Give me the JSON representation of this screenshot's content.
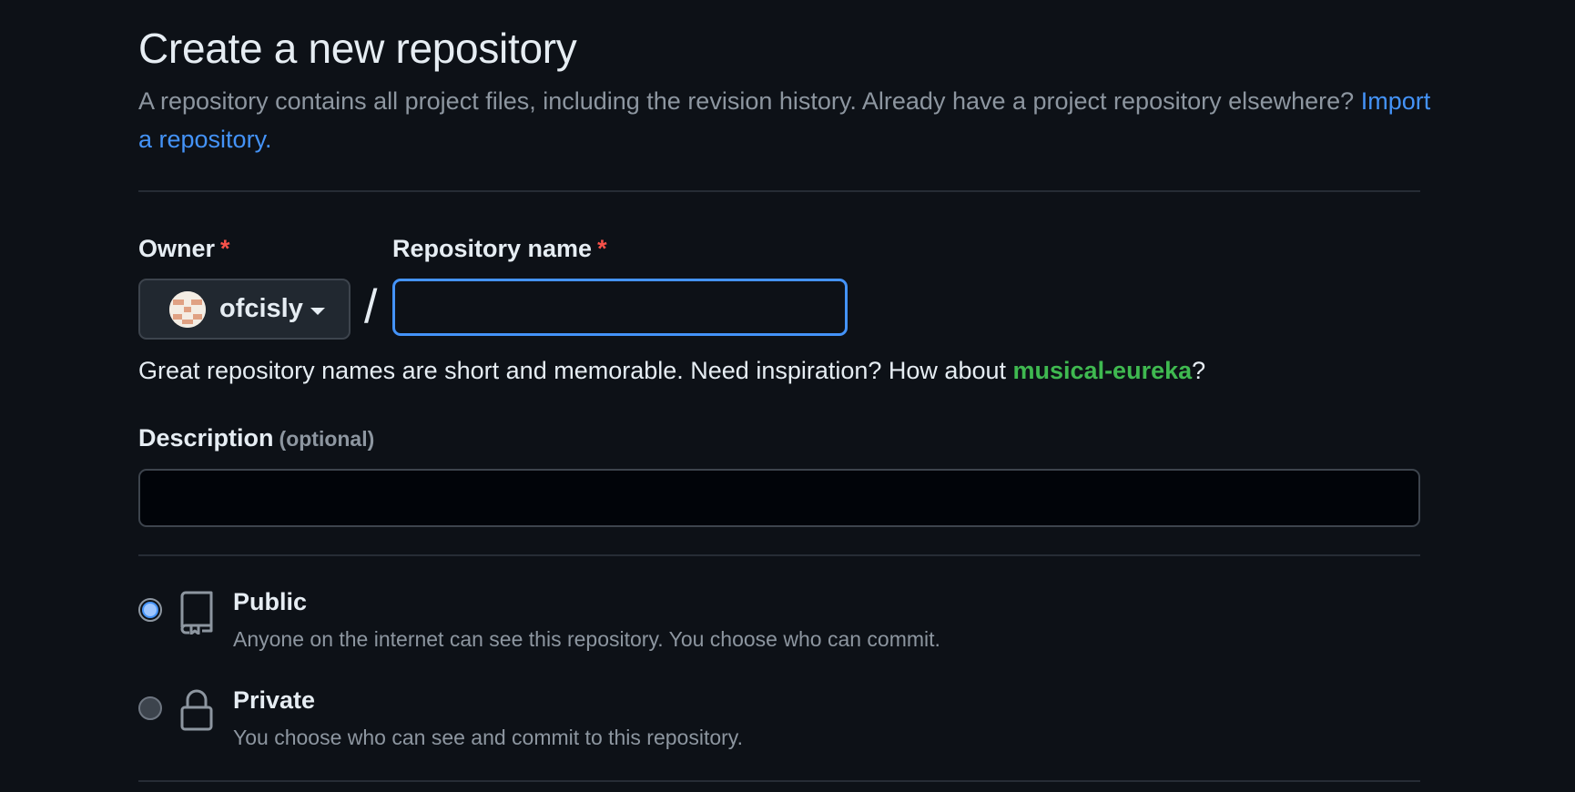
{
  "page": {
    "title": "Create a new repository",
    "intro_text": "A repository contains all project files, including the revision history. Already have a project repository elsewhere?",
    "import_link": "Import a repository."
  },
  "owner": {
    "label": "Owner",
    "required_mark": "*",
    "selected": "ofcisly",
    "avatar_icon": "identicon-avatar"
  },
  "separator": "/",
  "repo_name": {
    "label": "Repository name",
    "required_mark": "*",
    "value": "",
    "focused": true
  },
  "name_hint": {
    "text": "Great repository names are short and memorable. Need inspiration? How about",
    "suggestion": "musical-eureka",
    "suffix": "?"
  },
  "description": {
    "label": "Description",
    "optional_text": "(optional)",
    "value": ""
  },
  "visibility": {
    "selected": "public",
    "options": [
      {
        "id": "public",
        "title": "Public",
        "description": "Anyone on the internet can see this repository. You choose who can commit.",
        "icon": "repo-icon"
      },
      {
        "id": "private",
        "title": "Private",
        "description": "You choose who can see and commit to this repository.",
        "icon": "lock-icon"
      }
    ]
  },
  "colors": {
    "background": "#0d1117",
    "link": "#4493f8",
    "suggestion": "#3fb950",
    "required": "#f85149",
    "focus_border": "#4493f8"
  }
}
